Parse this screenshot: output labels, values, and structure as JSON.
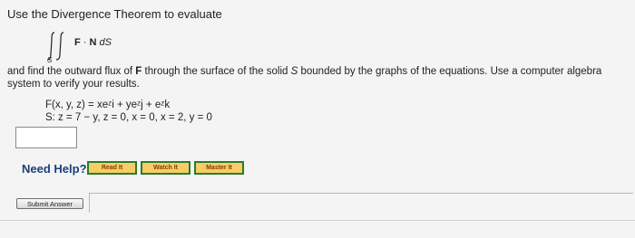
{
  "intro": "Use the Divergence Theorem to evaluate",
  "integral": {
    "subscript": "S",
    "vector": "F",
    "dot": "·",
    "normal": "N",
    "differential": "dS"
  },
  "instructions": {
    "part1": "and find the outward flux of ",
    "F": "F",
    "part2": " through the surface of the solid ",
    "solid": "S",
    "part3": " bounded by the graphs of the equations. Use a computer algebra system to verify your results."
  },
  "equations": {
    "field": "F(x, y, z) = xeᶻi + yeᶻj + eᶻk",
    "surface": "S: z = 7 − y, z = 0, x = 0, x = 2, y = 0"
  },
  "answer": {
    "value": ""
  },
  "help": {
    "label": "Need Help?",
    "read": "Read It",
    "watch": "Watch It",
    "master": "Master It"
  },
  "submit": {
    "label": "Submit Answer"
  }
}
